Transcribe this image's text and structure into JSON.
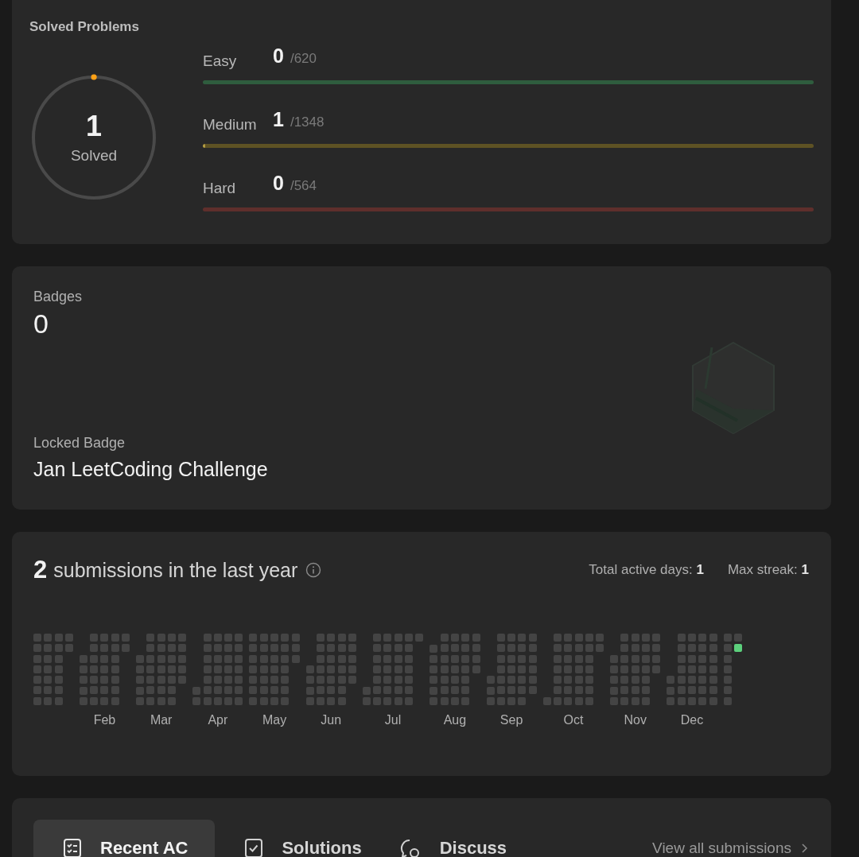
{
  "solved": {
    "title": "Solved Problems",
    "count": "1",
    "count_label": "Solved",
    "level": 0.0004,
    "difficulties": [
      {
        "label": "Easy",
        "solved": "0",
        "total": "/620",
        "level": 0,
        "color": "#2f5d3e"
      },
      {
        "label": "Medium",
        "solved": "1",
        "total": "/1348",
        "level": 0.004,
        "color": "#5e5224"
      },
      {
        "label": "Hard",
        "solved": "0",
        "total": "/564",
        "level": 0,
        "color": "#5f2f2c"
      }
    ]
  },
  "badges": {
    "title": "Badges",
    "count": "0",
    "locked_label": "Locked Badge",
    "locked_name": "Jan LeetCoding Challenge"
  },
  "submissions": {
    "count": "2",
    "text": "submissions in the last year",
    "stats": [
      {
        "label": "Total active days:",
        "value": "1"
      },
      {
        "label": "Max streak:",
        "value": "1"
      }
    ],
    "months": [
      {
        "weeks": [
          {
            "kind": "week",
            "days": [
              {
                "active": false
              },
              {
                "active": false
              },
              {
                "active": false
              },
              {
                "active": false
              },
              {
                "active": false
              },
              {
                "active": false
              },
              {
                "active": false
              }
            ]
          },
          {
            "kind": "week",
            "days": [
              {
                "active": false
              },
              {
                "active": false
              },
              {
                "active": false
              },
              {
                "active": false
              },
              {
                "active": false
              },
              {
                "active": false
              },
              {
                "active": false
              }
            ]
          },
          {
            "kind": "week",
            "days": [
              {
                "active": false
              },
              {
                "active": false
              },
              {
                "active": false
              },
              {
                "active": false
              },
              {
                "active": false
              },
              {
                "active": false
              },
              {
                "active": false
              }
            ]
          },
          {
            "kind": "end",
            "days": [
              {
                "active": false
              },
              {
                "active": false
              }
            ]
          }
        ]
      },
      {
        "label": "Feb",
        "weeks": [
          {
            "kind": "start",
            "days": [
              {
                "active": false
              },
              {
                "active": false
              },
              {
                "active": false
              },
              {
                "active": false
              },
              {
                "active": false
              }
            ]
          },
          {
            "kind": "week",
            "days": [
              {
                "active": false
              },
              {
                "active": false
              },
              {
                "active": false
              },
              {
                "active": false
              },
              {
                "active": false
              },
              {
                "active": false
              },
              {
                "active": false
              }
            ]
          },
          {
            "kind": "week",
            "days": [
              {
                "active": false
              },
              {
                "active": false
              },
              {
                "active": false
              },
              {
                "active": false
              },
              {
                "active": false
              },
              {
                "active": false
              },
              {
                "active": false
              }
            ]
          },
          {
            "kind": "week",
            "days": [
              {
                "active": false
              },
              {
                "active": false
              },
              {
                "active": false
              },
              {
                "active": false
              },
              {
                "active": false
              },
              {
                "active": false
              },
              {
                "active": false
              }
            ]
          },
          {
            "kind": "end",
            "days": [
              {
                "active": false
              },
              {
                "active": false
              }
            ]
          }
        ]
      },
      {
        "label": "Mar",
        "weeks": [
          {
            "kind": "start",
            "days": [
              {
                "active": false
              },
              {
                "active": false
              },
              {
                "active": false
              },
              {
                "active": false
              },
              {
                "active": false
              }
            ]
          },
          {
            "kind": "week",
            "days": [
              {
                "active": false
              },
              {
                "active": false
              },
              {
                "active": false
              },
              {
                "active": false
              },
              {
                "active": false
              },
              {
                "active": false
              },
              {
                "active": false
              }
            ]
          },
          {
            "kind": "week",
            "days": [
              {
                "active": false
              },
              {
                "active": false
              },
              {
                "active": false
              },
              {
                "active": false
              },
              {
                "active": false
              },
              {
                "active": false
              },
              {
                "active": false
              }
            ]
          },
          {
            "kind": "week",
            "days": [
              {
                "active": false
              },
              {
                "active": false
              },
              {
                "active": false
              },
              {
                "active": false
              },
              {
                "active": false
              },
              {
                "active": false
              },
              {
                "active": false
              }
            ]
          },
          {
            "kind": "end",
            "days": [
              {
                "active": false
              },
              {
                "active": false
              },
              {
                "active": false
              },
              {
                "active": false
              },
              {
                "active": false
              }
            ]
          }
        ]
      },
      {
        "label": "Apr",
        "weeks": [
          {
            "kind": "start",
            "days": [
              {
                "active": false
              },
              {
                "active": false
              }
            ]
          },
          {
            "kind": "week",
            "days": [
              {
                "active": false
              },
              {
                "active": false
              },
              {
                "active": false
              },
              {
                "active": false
              },
              {
                "active": false
              },
              {
                "active": false
              },
              {
                "active": false
              }
            ]
          },
          {
            "kind": "week",
            "days": [
              {
                "active": false
              },
              {
                "active": false
              },
              {
                "active": false
              },
              {
                "active": false
              },
              {
                "active": false
              },
              {
                "active": false
              },
              {
                "active": false
              }
            ]
          },
          {
            "kind": "week",
            "days": [
              {
                "active": false
              },
              {
                "active": false
              },
              {
                "active": false
              },
              {
                "active": false
              },
              {
                "active": false
              },
              {
                "active": false
              },
              {
                "active": false
              }
            ]
          },
          {
            "kind": "week",
            "days": [
              {
                "active": false
              },
              {
                "active": false
              },
              {
                "active": false
              },
              {
                "active": false
              },
              {
                "active": false
              },
              {
                "active": false
              },
              {
                "active": false
              }
            ]
          }
        ]
      },
      {
        "label": "May",
        "weeks": [
          {
            "kind": "week",
            "days": [
              {
                "active": false
              },
              {
                "active": false
              },
              {
                "active": false
              },
              {
                "active": false
              },
              {
                "active": false
              },
              {
                "active": false
              },
              {
                "active": false
              }
            ]
          },
          {
            "kind": "week",
            "days": [
              {
                "active": false
              },
              {
                "active": false
              },
              {
                "active": false
              },
              {
                "active": false
              },
              {
                "active": false
              },
              {
                "active": false
              },
              {
                "active": false
              }
            ]
          },
          {
            "kind": "week",
            "days": [
              {
                "active": false
              },
              {
                "active": false
              },
              {
                "active": false
              },
              {
                "active": false
              },
              {
                "active": false
              },
              {
                "active": false
              },
              {
                "active": false
              }
            ]
          },
          {
            "kind": "week",
            "days": [
              {
                "active": false
              },
              {
                "active": false
              },
              {
                "active": false
              },
              {
                "active": false
              },
              {
                "active": false
              },
              {
                "active": false
              },
              {
                "active": false
              }
            ]
          },
          {
            "kind": "end",
            "days": [
              {
                "active": false
              },
              {
                "active": false
              },
              {
                "active": false
              }
            ]
          }
        ]
      },
      {
        "label": "Jun",
        "weeks": [
          {
            "kind": "start",
            "days": [
              {
                "active": false
              },
              {
                "active": false
              },
              {
                "active": false
              },
              {
                "active": false
              }
            ]
          },
          {
            "kind": "week",
            "days": [
              {
                "active": false
              },
              {
                "active": false
              },
              {
                "active": false
              },
              {
                "active": false
              },
              {
                "active": false
              },
              {
                "active": false
              },
              {
                "active": false
              }
            ]
          },
          {
            "kind": "week",
            "days": [
              {
                "active": false
              },
              {
                "active": false
              },
              {
                "active": false
              },
              {
                "active": false
              },
              {
                "active": false
              },
              {
                "active": false
              },
              {
                "active": false
              }
            ]
          },
          {
            "kind": "week",
            "days": [
              {
                "active": false
              },
              {
                "active": false
              },
              {
                "active": false
              },
              {
                "active": false
              },
              {
                "active": false
              },
              {
                "active": false
              },
              {
                "active": false
              }
            ]
          },
          {
            "kind": "end",
            "days": [
              {
                "active": false
              },
              {
                "active": false
              },
              {
                "active": false
              },
              {
                "active": false
              },
              {
                "active": false
              }
            ]
          }
        ]
      },
      {
        "label": "Jul",
        "weeks": [
          {
            "kind": "start",
            "days": [
              {
                "active": false
              },
              {
                "active": false
              }
            ]
          },
          {
            "kind": "week",
            "days": [
              {
                "active": false
              },
              {
                "active": false
              },
              {
                "active": false
              },
              {
                "active": false
              },
              {
                "active": false
              },
              {
                "active": false
              },
              {
                "active": false
              }
            ]
          },
          {
            "kind": "week",
            "days": [
              {
                "active": false
              },
              {
                "active": false
              },
              {
                "active": false
              },
              {
                "active": false
              },
              {
                "active": false
              },
              {
                "active": false
              },
              {
                "active": false
              }
            ]
          },
          {
            "kind": "week",
            "days": [
              {
                "active": false
              },
              {
                "active": false
              },
              {
                "active": false
              },
              {
                "active": false
              },
              {
                "active": false
              },
              {
                "active": false
              },
              {
                "active": false
              }
            ]
          },
          {
            "kind": "week",
            "days": [
              {
                "active": false
              },
              {
                "active": false
              },
              {
                "active": false
              },
              {
                "active": false
              },
              {
                "active": false
              },
              {
                "active": false
              },
              {
                "active": false
              }
            ]
          },
          {
            "kind": "end",
            "days": [
              {
                "active": false
              }
            ]
          }
        ]
      },
      {
        "label": "Aug",
        "weeks": [
          {
            "kind": "start",
            "days": [
              {
                "active": false
              },
              {
                "active": false
              },
              {
                "active": false
              },
              {
                "active": false
              },
              {
                "active": false
              },
              {
                "active": false
              }
            ]
          },
          {
            "kind": "week",
            "days": [
              {
                "active": false
              },
              {
                "active": false
              },
              {
                "active": false
              },
              {
                "active": false
              },
              {
                "active": false
              },
              {
                "active": false
              },
              {
                "active": false
              }
            ]
          },
          {
            "kind": "week",
            "days": [
              {
                "active": false
              },
              {
                "active": false
              },
              {
                "active": false
              },
              {
                "active": false
              },
              {
                "active": false
              },
              {
                "active": false
              },
              {
                "active": false
              }
            ]
          },
          {
            "kind": "week",
            "days": [
              {
                "active": false
              },
              {
                "active": false
              },
              {
                "active": false
              },
              {
                "active": false
              },
              {
                "active": false
              },
              {
                "active": false
              },
              {
                "active": false
              }
            ]
          },
          {
            "kind": "end",
            "days": [
              {
                "active": false
              },
              {
                "active": false
              },
              {
                "active": false
              },
              {
                "active": false
              }
            ]
          }
        ]
      },
      {
        "label": "Sep",
        "weeks": [
          {
            "kind": "start",
            "days": [
              {
                "active": false
              },
              {
                "active": false
              },
              {
                "active": false
              }
            ]
          },
          {
            "kind": "week",
            "days": [
              {
                "active": false
              },
              {
                "active": false
              },
              {
                "active": false
              },
              {
                "active": false
              },
              {
                "active": false
              },
              {
                "active": false
              },
              {
                "active": false
              }
            ]
          },
          {
            "kind": "week",
            "days": [
              {
                "active": false
              },
              {
                "active": false
              },
              {
                "active": false
              },
              {
                "active": false
              },
              {
                "active": false
              },
              {
                "active": false
              },
              {
                "active": false
              }
            ]
          },
          {
            "kind": "week",
            "days": [
              {
                "active": false
              },
              {
                "active": false
              },
              {
                "active": false
              },
              {
                "active": false
              },
              {
                "active": false
              },
              {
                "active": false
              },
              {
                "active": false
              }
            ]
          },
          {
            "kind": "end",
            "days": [
              {
                "active": false
              },
              {
                "active": false
              },
              {
                "active": false
              },
              {
                "active": false
              },
              {
                "active": false
              },
              {
                "active": false
              }
            ]
          }
        ]
      },
      {
        "label": "Oct",
        "weeks": [
          {
            "kind": "start",
            "days": [
              {
                "active": false
              }
            ]
          },
          {
            "kind": "week",
            "days": [
              {
                "active": false
              },
              {
                "active": false
              },
              {
                "active": false
              },
              {
                "active": false
              },
              {
                "active": false
              },
              {
                "active": false
              },
              {
                "active": false
              }
            ]
          },
          {
            "kind": "week",
            "days": [
              {
                "active": false
              },
              {
                "active": false
              },
              {
                "active": false
              },
              {
                "active": false
              },
              {
                "active": false
              },
              {
                "active": false
              },
              {
                "active": false
              }
            ]
          },
          {
            "kind": "week",
            "days": [
              {
                "active": false
              },
              {
                "active": false
              },
              {
                "active": false
              },
              {
                "active": false
              },
              {
                "active": false
              },
              {
                "active": false
              },
              {
                "active": false
              }
            ]
          },
          {
            "kind": "week",
            "days": [
              {
                "active": false
              },
              {
                "active": false
              },
              {
                "active": false
              },
              {
                "active": false
              },
              {
                "active": false
              },
              {
                "active": false
              },
              {
                "active": false
              }
            ]
          },
          {
            "kind": "end",
            "days": [
              {
                "active": false
              },
              {
                "active": false
              }
            ]
          }
        ]
      },
      {
        "label": "Nov",
        "weeks": [
          {
            "kind": "start",
            "days": [
              {
                "active": false
              },
              {
                "active": false
              },
              {
                "active": false
              },
              {
                "active": false
              },
              {
                "active": false
              }
            ]
          },
          {
            "kind": "week",
            "days": [
              {
                "active": false
              },
              {
                "active": false
              },
              {
                "active": false
              },
              {
                "active": false
              },
              {
                "active": false
              },
              {
                "active": false
              },
              {
                "active": false
              }
            ]
          },
          {
            "kind": "week",
            "days": [
              {
                "active": false
              },
              {
                "active": false
              },
              {
                "active": false
              },
              {
                "active": false
              },
              {
                "active": false
              },
              {
                "active": false
              },
              {
                "active": false
              }
            ]
          },
          {
            "kind": "week",
            "days": [
              {
                "active": false
              },
              {
                "active": false
              },
              {
                "active": false
              },
              {
                "active": false
              },
              {
                "active": false
              },
              {
                "active": false
              },
              {
                "active": false
              }
            ]
          },
          {
            "kind": "end",
            "days": [
              {
                "active": false
              },
              {
                "active": false
              },
              {
                "active": false
              },
              {
                "active": false
              }
            ]
          }
        ]
      },
      {
        "label": "Dec",
        "weeks": [
          {
            "kind": "start",
            "days": [
              {
                "active": false
              },
              {
                "active": false
              },
              {
                "active": false
              }
            ]
          },
          {
            "kind": "week",
            "days": [
              {
                "active": false
              },
              {
                "active": false
              },
              {
                "active": false
              },
              {
                "active": false
              },
              {
                "active": false
              },
              {
                "active": false
              },
              {
                "active": false
              }
            ]
          },
          {
            "kind": "week",
            "days": [
              {
                "active": false
              },
              {
                "active": false
              },
              {
                "active": false
              },
              {
                "active": false
              },
              {
                "active": false
              },
              {
                "active": false
              },
              {
                "active": false
              }
            ]
          },
          {
            "kind": "week",
            "days": [
              {
                "active": false
              },
              {
                "active": false
              },
              {
                "active": false
              },
              {
                "active": false
              },
              {
                "active": false
              },
              {
                "active": false
              },
              {
                "active": false
              }
            ]
          },
          {
            "kind": "week",
            "days": [
              {
                "active": false
              },
              {
                "active": false
              },
              {
                "active": false
              },
              {
                "active": false
              },
              {
                "active": false
              },
              {
                "active": false
              },
              {
                "active": false
              }
            ]
          }
        ]
      },
      {
        "weeks": [
          {
            "kind": "week",
            "days": [
              {
                "active": false
              },
              {
                "active": false
              },
              {
                "active": false
              },
              {
                "active": false
              },
              {
                "active": false
              },
              {
                "active": false
              },
              {
                "active": false
              }
            ]
          },
          {
            "kind": "end",
            "days": [
              {
                "active": false
              },
              {
                "active": true
              }
            ]
          }
        ]
      }
    ]
  },
  "tabs": [
    {
      "label": "Recent AC",
      "kind": "list",
      "selected": true
    },
    {
      "label": "Solutions",
      "kind": "check",
      "selected": false
    },
    {
      "label": "Discuss",
      "kind": "chat",
      "selected": false
    }
  ],
  "view_all": "View all submissions"
}
